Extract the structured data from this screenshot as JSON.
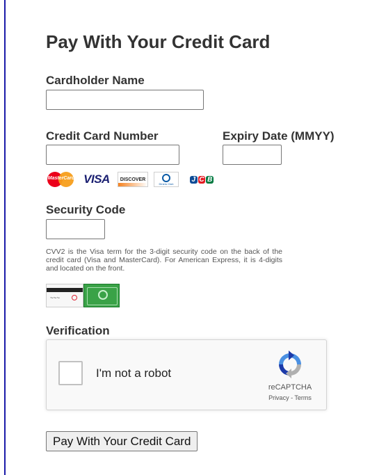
{
  "form": {
    "title": "Pay With Your Credit Card",
    "cardholder_name": {
      "label": "Cardholder Name",
      "value": "",
      "placeholder": ""
    },
    "card_number": {
      "label": "Credit Card Number",
      "value": "",
      "placeholder": ""
    },
    "expiry": {
      "label": "Expiry Date (MMYY)",
      "value": "",
      "placeholder": ""
    },
    "accepted_cards": [
      "mastercard-icon",
      "visa-icon",
      "discover-icon",
      "diners-club-icon",
      "jcb-icon"
    ],
    "card_logo_text": {
      "mastercard": "MasterCard",
      "visa": "VISA",
      "discover": "DISCOVER",
      "diners": "Diners Club",
      "jcb_j": "J",
      "jcb_c": "C",
      "jcb_b": "B"
    },
    "security_code": {
      "label": "Security Code",
      "value": "",
      "placeholder": "",
      "help": "CVV2 is the Visa term for the 3-digit security code on the back of the credit card (Visa and MasterCard). For American Express, it is 4-digits and located on the front."
    },
    "verification": {
      "label": "Verification",
      "checkbox_label": "I'm not a robot",
      "checked": false,
      "brand": "reCAPTCHA",
      "privacy": "Privacy",
      "separator": " - ",
      "terms": "Terms"
    },
    "submit_label": "Pay With Your Credit Card"
  },
  "colors": {
    "left_rule": "#1a1aa8",
    "recaptcha_blue": "#4a90e2",
    "recaptcha_dark_blue": "#1c3aa9",
    "recaptcha_gray": "#b0b0b0"
  }
}
